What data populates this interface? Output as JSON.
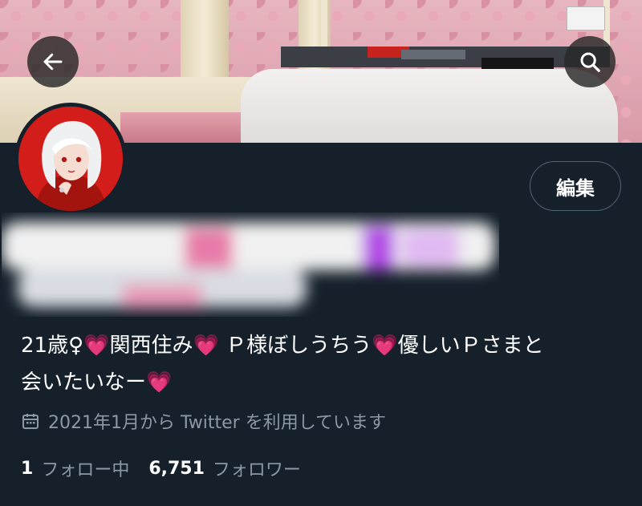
{
  "header": {
    "back_icon": "arrow-left-icon",
    "search_icon": "search-icon"
  },
  "profile": {
    "edit_button_label": "編集",
    "bio": {
      "seg1": "21歳♀",
      "seg2": "関西住み",
      "seg3": "Ｐ様ぼしうちう",
      "seg4": "優しいＰさまと",
      "seg5": "会いたいなー",
      "heart1": "💗",
      "heart2": "💗",
      "heart3": "💗",
      "heart4": "💗"
    },
    "joined_text": "2021年1月から Twitter を利用しています",
    "joined_icon": "calendar-icon",
    "following_count": "1",
    "following_label": "フォロー中",
    "followers_count": "6,751",
    "followers_label": "フォロワー"
  },
  "colors": {
    "background": "#15202b",
    "secondary_text": "#8b98a5",
    "border": "#536471",
    "heart": "#f472b6"
  }
}
